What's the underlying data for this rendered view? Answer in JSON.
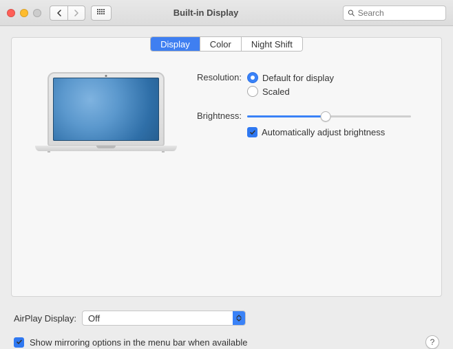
{
  "window": {
    "title": "Built-in Display"
  },
  "search": {
    "placeholder": "Search"
  },
  "tabs": {
    "display": "Display",
    "color": "Color",
    "night_shift": "Night Shift",
    "active": "display"
  },
  "resolution": {
    "label": "Resolution:",
    "default_label": "Default for display",
    "scaled_label": "Scaled",
    "selected": "default"
  },
  "brightness": {
    "label": "Brightness:",
    "value_pct": 48,
    "auto_label": "Automatically adjust brightness",
    "auto_checked": true
  },
  "airplay": {
    "label": "AirPlay Display:",
    "value": "Off"
  },
  "mirroring": {
    "label": "Show mirroring options in the menu bar when available",
    "checked": true
  },
  "help": {
    "symbol": "?"
  }
}
